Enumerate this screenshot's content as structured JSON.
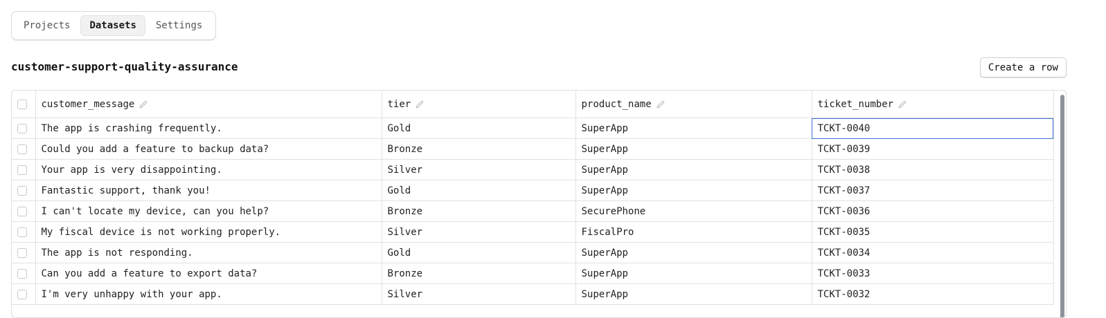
{
  "tabs": [
    {
      "label": "Projects",
      "active": false
    },
    {
      "label": "Datasets",
      "active": true
    },
    {
      "label": "Settings",
      "active": false
    }
  ],
  "dataset_title": "customer-support-quality-assurance",
  "create_row_label": "Create a row",
  "columns": [
    "customer_message",
    "tier",
    "product_name",
    "ticket_number"
  ],
  "rows": [
    [
      "The app is crashing frequently.",
      "Gold",
      "SuperApp",
      "TCKT-0040"
    ],
    [
      "Could you add a feature to backup data?",
      "Bronze",
      "SuperApp",
      "TCKT-0039"
    ],
    [
      "Your app is very disappointing.",
      "Silver",
      "SuperApp",
      "TCKT-0038"
    ],
    [
      "Fantastic support, thank you!",
      "Gold",
      "SuperApp",
      "TCKT-0037"
    ],
    [
      "I can't locate my device, can you help?",
      "Bronze",
      "SecurePhone",
      "TCKT-0036"
    ],
    [
      "My fiscal device is not working properly.",
      "Silver",
      "FiscalPro",
      "TCKT-0035"
    ],
    [
      "The app is not responding.",
      "Gold",
      "SuperApp",
      "TCKT-0034"
    ],
    [
      "Can you add a feature to export data?",
      "Bronze",
      "SuperApp",
      "TCKT-0033"
    ],
    [
      "I'm very unhappy with your app.",
      "Silver",
      "SuperApp",
      "TCKT-0032"
    ]
  ],
  "selected_cell": {
    "row": 0,
    "column": 3
  },
  "colors": {
    "selection": "#3b6fd0",
    "border": "#e1e1e1"
  },
  "icons": {
    "column_edit": "pencil-icon"
  }
}
